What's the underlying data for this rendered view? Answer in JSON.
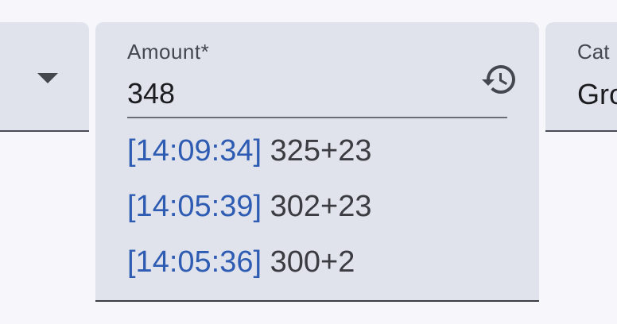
{
  "left_field": {
    "icon": "arrow-drop-down-icon"
  },
  "amount_field": {
    "label": "Amount*",
    "value": "348",
    "history_icon": "history-icon",
    "history": [
      {
        "time": "[14:09:34]",
        "expression": "325+23"
      },
      {
        "time": "[14:05:39]",
        "expression": "302+23"
      },
      {
        "time": "[14:05:36]",
        "expression": "300+2"
      }
    ]
  },
  "category_field": {
    "label": "Cat",
    "value": "Gro"
  },
  "colors": {
    "field_background": "#e0e3eb",
    "page_background": "#f7f7fb",
    "timestamp_blue": "#2f5cb3",
    "text_dark": "#1b1c20"
  }
}
